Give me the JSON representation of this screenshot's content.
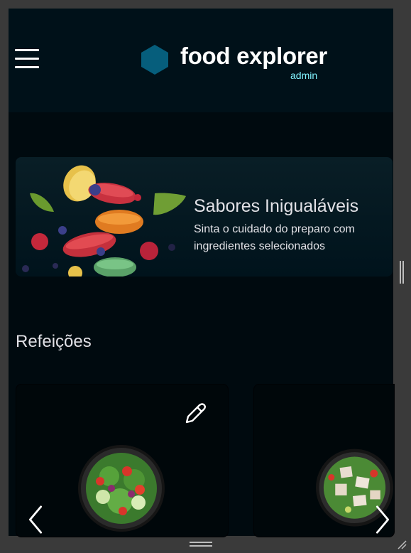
{
  "header": {
    "logo_title": "food explorer",
    "logo_subtitle": "admin"
  },
  "banner": {
    "title": "Sabores Inigualáveis",
    "text": "Sinta o cuidado do preparo com ingredientes selecionados"
  },
  "sections": [
    {
      "title": "Refeições",
      "cards": [
        {
          "image": "salad-dish",
          "editable": true
        },
        {
          "image": "chicken-salad-dish",
          "editable": false
        }
      ]
    }
  ],
  "icons": {
    "menu": "hamburger-icon",
    "logo": "hexagon-logo-icon",
    "edit": "pencil-icon",
    "prev": "chevron-left-icon",
    "next": "chevron-right-icon"
  },
  "colors": {
    "background": "#000a0f",
    "header": "#001119",
    "logo": "#065e7c",
    "accent_text": "#82f3ff",
    "text": "#e1e1e6"
  }
}
